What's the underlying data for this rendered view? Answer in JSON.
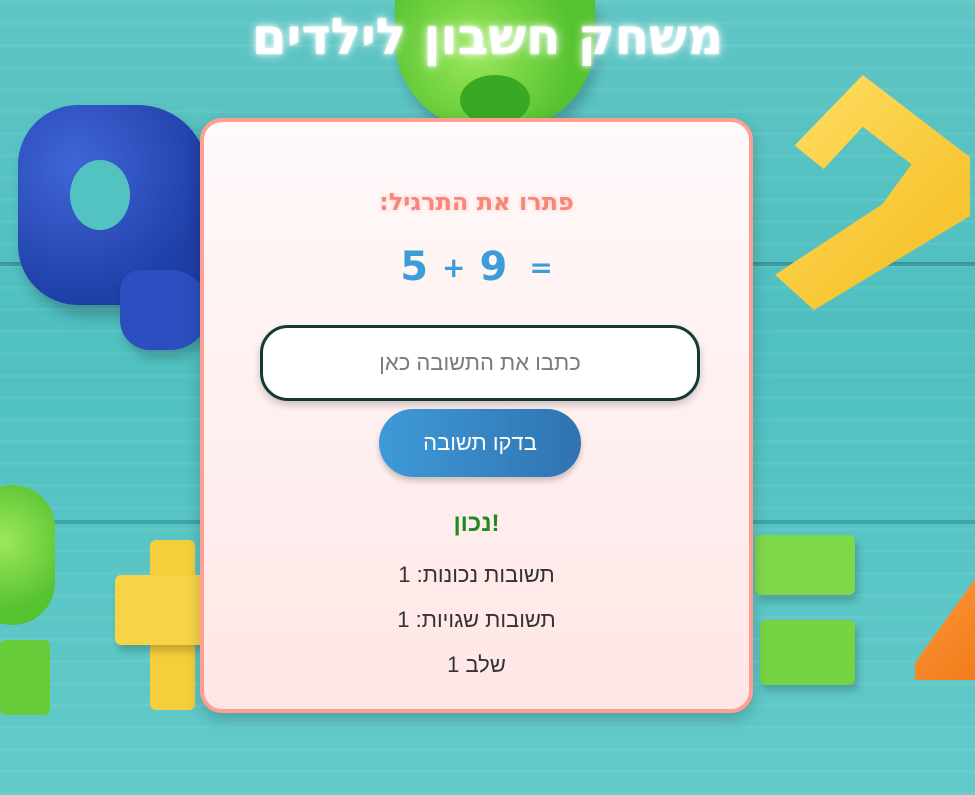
{
  "page": {
    "title": "משחק חשבון לילדים"
  },
  "card": {
    "instruction": "פתרו את התרגיל:",
    "problem": {
      "a": "5",
      "op": "+",
      "b": "9",
      "eq": "="
    },
    "input": {
      "value": "",
      "placeholder": "כתבו את התשובה כאן"
    },
    "check_button": "בדקו תשובה",
    "feedback": "!נכון",
    "stats": {
      "correct": "תשובות נכונות: 1",
      "wrong": "תשובות שגויות: 1",
      "level": "שלב 1"
    }
  },
  "colors": {
    "accent": "#3d9dd8",
    "card_border": "#ff9f94",
    "feedback": "#1f8a1f"
  }
}
